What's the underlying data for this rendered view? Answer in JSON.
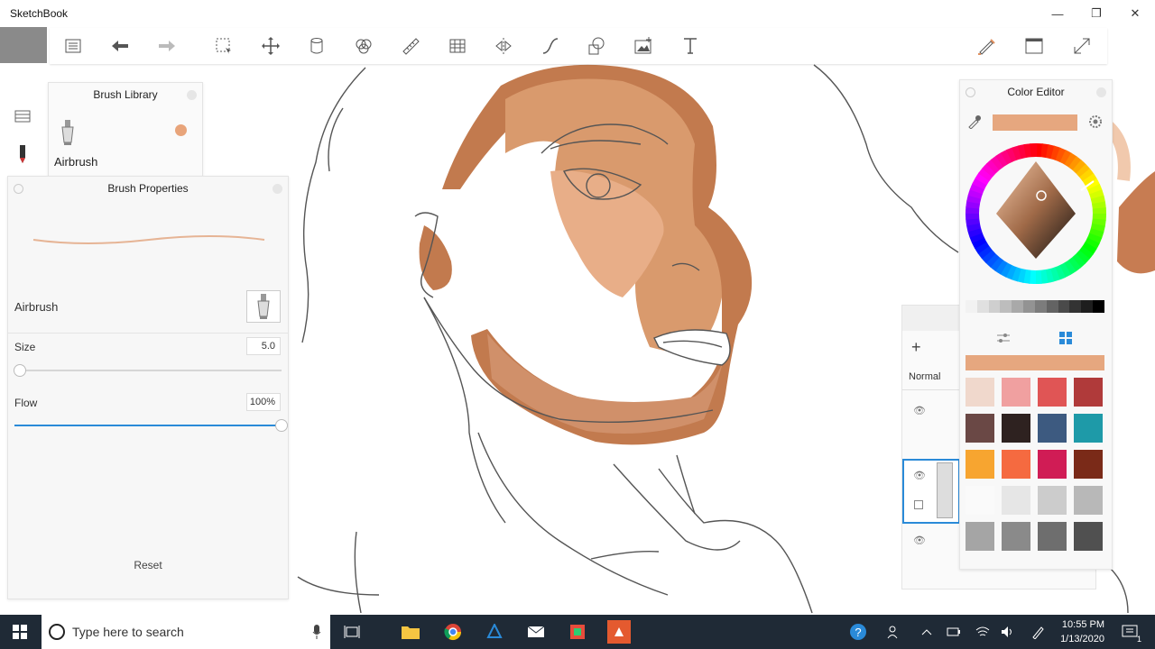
{
  "window": {
    "title": "SketchBook"
  },
  "brush_library": {
    "title": "Brush Library",
    "selected_brush": "Airbrush"
  },
  "brush_properties": {
    "title": "Brush Properties",
    "brush_name": "Airbrush",
    "size_label": "Size",
    "size_value": "5.0",
    "size_fraction": 0.02,
    "flow_label": "Flow",
    "flow_value": "100%",
    "flow_fraction": 1.0,
    "reset_label": "Reset"
  },
  "layers": {
    "blend_mode": "Normal"
  },
  "color_editor": {
    "title": "Color Editor",
    "current_color": "#e6a77f",
    "swatches": [
      "#f0d8cc",
      "#f0a0a0",
      "#e05555",
      "#b03a3a",
      "#6a4845",
      "#2e2220",
      "#3d5a80",
      "#1e9aa8",
      "#f7a530",
      "#f56a40",
      "#d01c55",
      "#7a2a18",
      "#fafafa",
      "#e6e6e6",
      "#cccccc",
      "#b8b8b8",
      "#a5a5a5",
      "#8a8a8a",
      "#6e6e6e",
      "#505050"
    ],
    "gray_strip": [
      "#f2f2f2",
      "#e0e0e0",
      "#cfcfcf",
      "#bdbdbd",
      "#a9a9a9",
      "#939393",
      "#7c7c7c",
      "#636363",
      "#4a4a4a",
      "#333333",
      "#1e1e1e",
      "#000000"
    ]
  },
  "toolbar": {
    "icons": [
      "menu-icon",
      "undo-icon",
      "redo-icon",
      "select-icon",
      "transform-icon",
      "layer-icon",
      "symmetry-icon",
      "ruler-icon",
      "perspective-icon",
      "flip-icon",
      "curve-icon",
      "shape-icon",
      "image-icon",
      "text-icon",
      "brush-icon",
      "window-icon",
      "fullscreen-icon"
    ]
  },
  "taskbar": {
    "search_placeholder": "Type here to search",
    "time": "10:55 PM",
    "date": "1/13/2020",
    "notification_count": "1"
  }
}
